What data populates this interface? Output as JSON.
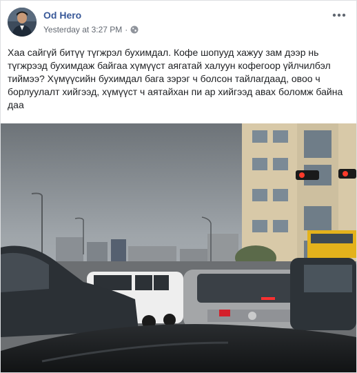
{
  "post": {
    "author": "Od Hero",
    "timestamp": "Yesterday at 3:27 PM",
    "separator": "·",
    "audience_icon": "globe-icon",
    "more_icon": "more-options-icon",
    "text": "Хаа сайгүй битүү түгжрэл бухимдал. Кофе шопууд хажуу зам дээр нь түгжрээд бухимдаж байгаа хүмүүст аягатай халуун кофегоор үйлчилбэл тиймээ? Хүмүүсийн бухимдал бага зэрэг ч болсон тайлагдаад, овоо ч борлуулалт хийгээд, хүмүүст ч аятайхан пи ар хийгээд авах боломж байна даа"
  },
  "colors": {
    "author_link": "#385898",
    "meta_text": "#616770",
    "body_text": "#1c1e21",
    "card_border": "#dddfe2"
  }
}
